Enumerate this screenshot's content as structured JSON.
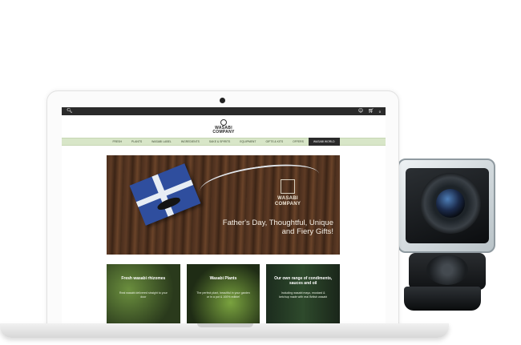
{
  "camera": {
    "icon": "action-camera-photo"
  },
  "laptop": {
    "icon": "laptop-mockup"
  },
  "site": {
    "topbar": {
      "search_icon": "search-icon",
      "user_icon": "user-icon",
      "cart_icon": "cart-icon",
      "cart_count": "0"
    },
    "logo": {
      "line1": "WASABI",
      "line2": "COMPANY"
    },
    "nav": {
      "items": [
        {
          "label": "FRESH"
        },
        {
          "label": "PLANTS"
        },
        {
          "label": "WASABI LABEL"
        },
        {
          "label": "INGREDIENTS"
        },
        {
          "label": "SAKE & SPIRITS"
        },
        {
          "label": "EQUIPMENT"
        },
        {
          "label": "GIFTS & KITS"
        },
        {
          "label": "OFFERS"
        },
        {
          "label": "WASABI WORLD"
        }
      ],
      "active_index": 8
    },
    "hero": {
      "logo_line1": "WASABI",
      "logo_line2": "COMPANY",
      "headline": "Father's Day, Thoughtful, Unique and Fiery Gifts!"
    },
    "tiles": [
      {
        "title": "Fresh wasabi rhizomes",
        "desc": "Real wasabi delivered straight to your door"
      },
      {
        "title": "Wasabi Plants",
        "desc": "The perfect plant, beautiful in your garden or in a pot & 100% edible!"
      },
      {
        "title": "Our own range of condiments, sauces and oil",
        "desc": "Including wasabi mayo, mustard & ketchup made with real British wasabi"
      }
    ]
  },
  "colors": {
    "topbar": "#2a2a2a",
    "nav_bg": "#d8e6c8",
    "nav_active": "#2a2a2a"
  }
}
